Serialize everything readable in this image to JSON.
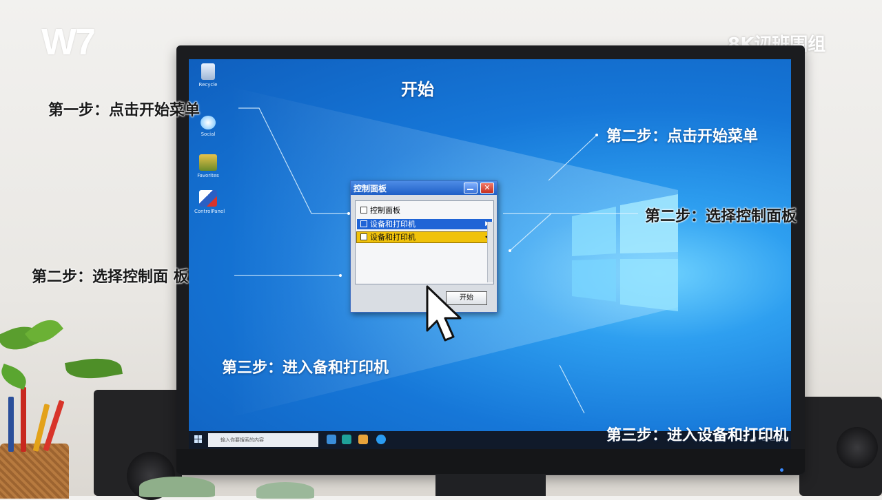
{
  "watermark": {
    "logo": "W7",
    "corner_title": "8K讱班围组"
  },
  "screen": {
    "title": "开始"
  },
  "desktop_icons": [
    {
      "name": "recycle-bin-icon",
      "label": "Recycle"
    },
    {
      "name": "network-icon",
      "label": "Social"
    },
    {
      "name": "folder-icon",
      "label": "Favorites"
    },
    {
      "name": "control-panel-icon",
      "label": "ControlPanel"
    }
  ],
  "dialog": {
    "title": "控制面板",
    "close_glyph": "✕",
    "items": [
      {
        "label": "控制面板",
        "checked": false,
        "state": "normal"
      },
      {
        "label": "设备和打印机",
        "checked": true,
        "state": "selected",
        "tail": "▶"
      },
      {
        "label": "设备和打印机",
        "checked": false,
        "state": "highlighted",
        "tail": "✔"
      }
    ],
    "ok_label": "开始"
  },
  "taskbar": {
    "search_placeholder": "输入你要搜索的内容",
    "tray": "◠ ▭ ◁ ▭▭▭"
  },
  "annotations": {
    "left_step1": "第一步：点击开始菜单",
    "left_step2": "第二步：选择控制面 板",
    "center_step3": "第三步：进入备和打印机",
    "right_step2a": "第二步：点击开始菜单",
    "right_step2b": "第二步：选择控制面板",
    "right_step3": "第三步：进入设备和打印机"
  },
  "colors": {
    "screen_blue": "#1677d8",
    "dialog_selected": "#1f64d6",
    "dialog_highlight": "#f0c20a"
  }
}
